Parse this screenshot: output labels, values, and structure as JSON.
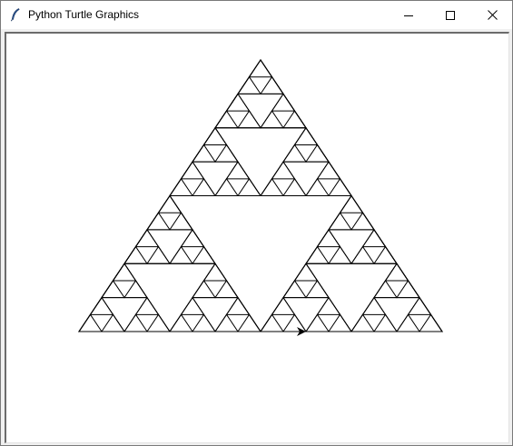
{
  "window": {
    "title": "Python Turtle Graphics",
    "app_icon": "feather-icon",
    "controls": [
      "minimize-icon",
      "maximize-icon",
      "close-icon"
    ]
  },
  "canvas": {
    "background": "#ffffff",
    "stroke_color": "#000000",
    "drawing": "sierpinski-triangle",
    "recursion_depth": 4,
    "turtle_cursor": "arrow-icon"
  }
}
